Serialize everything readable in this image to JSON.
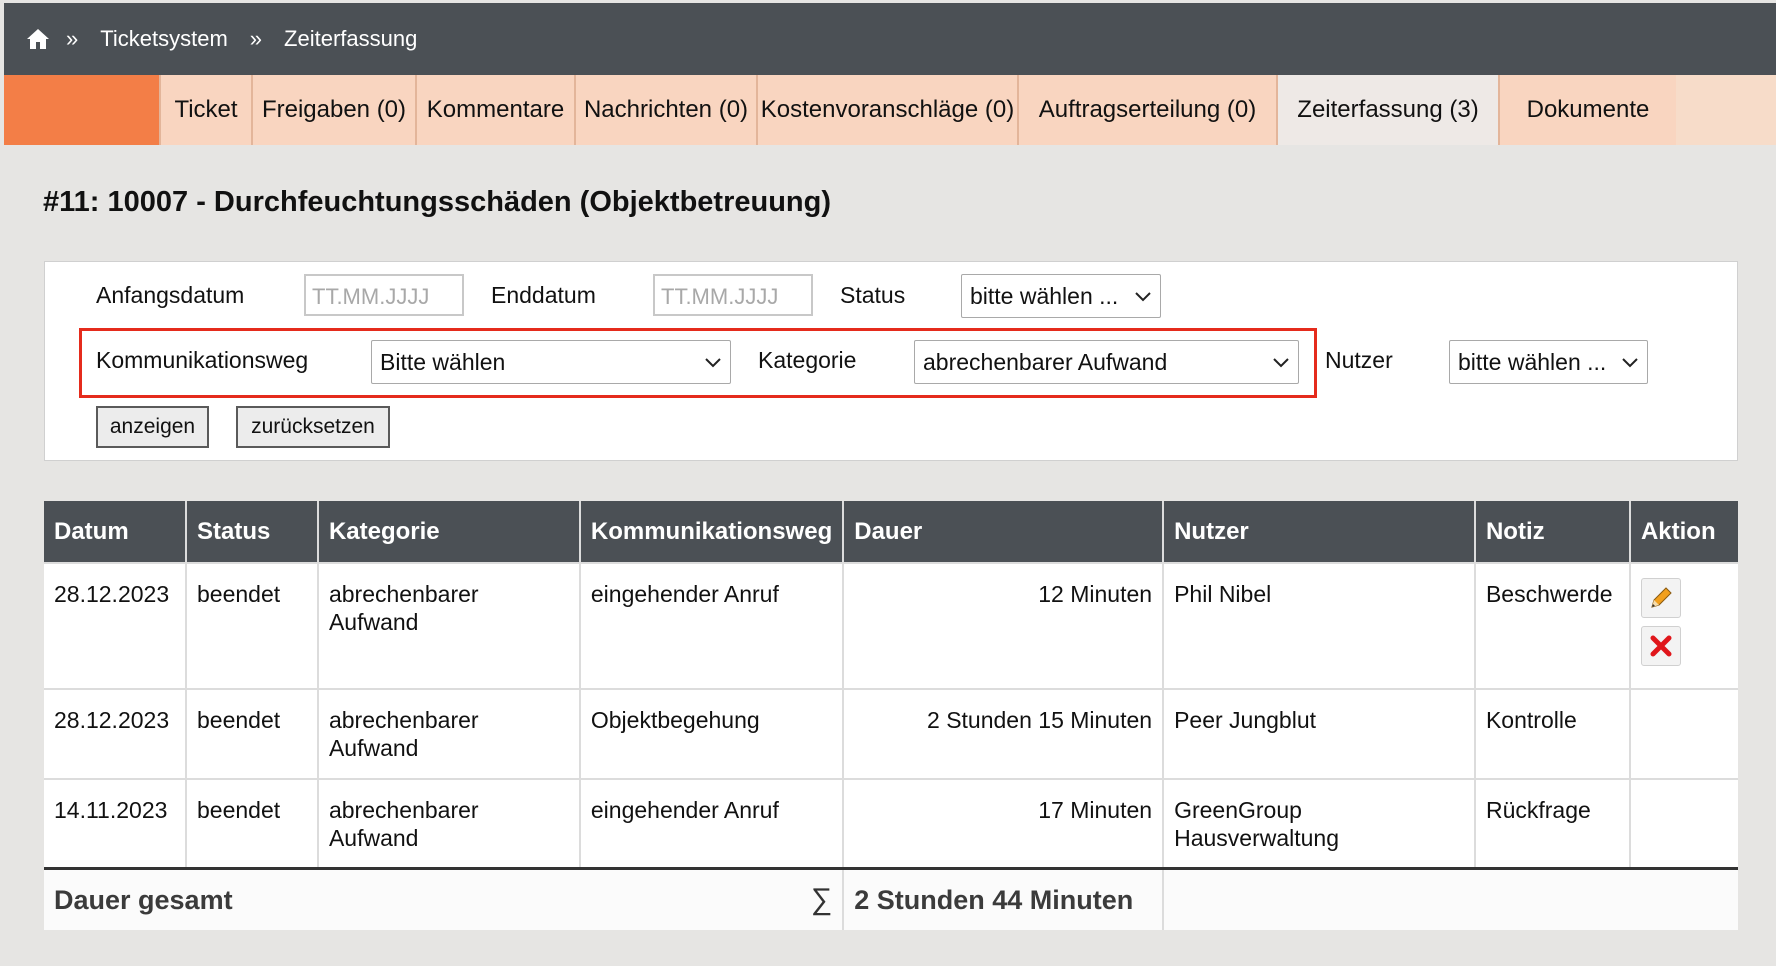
{
  "breadcrumb": {
    "home_icon": "home-icon",
    "separator": "»",
    "items": [
      "Ticketsystem",
      "Zeiterfassung"
    ]
  },
  "tabs": [
    {
      "label": "Ticket"
    },
    {
      "label": "Freigaben (0)"
    },
    {
      "label": "Kommentare"
    },
    {
      "label": "Nachrichten (0)"
    },
    {
      "label": "Kostenvoranschläge (0)"
    },
    {
      "label": "Auftragserteilung (0)"
    },
    {
      "label": "Zeiterfassung (3)"
    },
    {
      "label": "Dokumente"
    }
  ],
  "page_title": "#11: 10007 - Durchfeuchtungsschäden (Objektbetreuung)",
  "filters": {
    "start_label": "Anfangsdatum",
    "start_placeholder": "TT.MM.JJJJ",
    "end_label": "Enddatum",
    "end_placeholder": "TT.MM.JJJJ",
    "status_label": "Status",
    "status_value": "bitte wählen ...",
    "channel_label": "Kommunikationsweg",
    "channel_value": "Bitte wählen",
    "category_label": "Kategorie",
    "category_value": "abrechenbarer Aufwand",
    "user_label": "Nutzer",
    "user_value": "bitte wählen ...",
    "show_button": "anzeigen",
    "reset_button": "zurücksetzen"
  },
  "table": {
    "headers": [
      "Datum",
      "Status",
      "Kategorie",
      "Kommunikationsweg",
      "Dauer",
      "Nutzer",
      "Notiz",
      "Aktion"
    ],
    "rows": [
      {
        "date": "28.12.2023",
        "status": "beendet",
        "category": "abrechenbarer Aufwand",
        "channel": "eingehender Anruf",
        "duration": "12 Minuten",
        "user": "Phil Nibel",
        "note": "Beschwerde"
      },
      {
        "date": "28.12.2023",
        "status": "beendet",
        "category": "abrechenbarer Aufwand",
        "channel": "Objektbegehung",
        "duration": "2 Stunden 15 Minuten",
        "user": "Peer Jungblut",
        "note": "Kontrolle"
      },
      {
        "date": "14.11.2023",
        "status": "beendet",
        "category": "abrechenbarer Aufwand",
        "channel": "eingehender Anruf",
        "duration": "17 Minuten",
        "user": "GreenGroup Hausverwaltung",
        "note": "Rückfrage"
      }
    ],
    "footer_label": "Dauer gesamt",
    "sum_symbol": "∑",
    "footer_total": "2 Stunden 44 Minuten"
  },
  "colors": {
    "header_bg": "#4b5055",
    "accent_orange": "#f37e47",
    "tab_bg": "#f9d5c0",
    "highlight_red": "#e52b1c"
  }
}
